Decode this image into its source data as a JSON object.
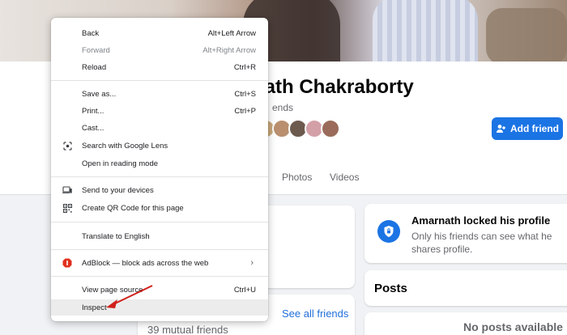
{
  "profile": {
    "name": "nath Chakraborty",
    "friends_subtitle": "ends",
    "add_friend_label": "Add friend",
    "tabs": [
      "Photos",
      "Videos"
    ],
    "avatar_colors": [
      "#c9a77a",
      "#b98f6f",
      "#6d5a4e",
      "#d4a0a8",
      "#9a6b5a"
    ],
    "locked_title": "Amarnath locked his profile",
    "locked_text": "Only his friends can see what he shares profile.",
    "posts_title": "Posts",
    "no_posts": "No posts available",
    "see_all_friends": "See all friends",
    "mutual_friends": "39 mutual friends",
    "accent": "#1b74e4"
  },
  "menu": {
    "back": {
      "label": "Back",
      "shortcut": "Alt+Left Arrow"
    },
    "forward": {
      "label": "Forward",
      "shortcut": "Alt+Right Arrow"
    },
    "reload": {
      "label": "Reload",
      "shortcut": "Ctrl+R"
    },
    "save_as": {
      "label": "Save as...",
      "shortcut": "Ctrl+S"
    },
    "print": {
      "label": "Print...",
      "shortcut": "Ctrl+P"
    },
    "cast": {
      "label": "Cast..."
    },
    "google_lens": {
      "label": "Search with Google Lens"
    },
    "reading_mode": {
      "label": "Open in reading mode"
    },
    "send_devices": {
      "label": "Send to your devices"
    },
    "qr_code": {
      "label": "Create QR Code for this page"
    },
    "translate": {
      "label": "Translate to English"
    },
    "adblock": {
      "label": "AdBlock — block ads across the web"
    },
    "view_source": {
      "label": "View page source",
      "shortcut": "Ctrl+U"
    },
    "inspect": {
      "label": "Inspect"
    }
  }
}
